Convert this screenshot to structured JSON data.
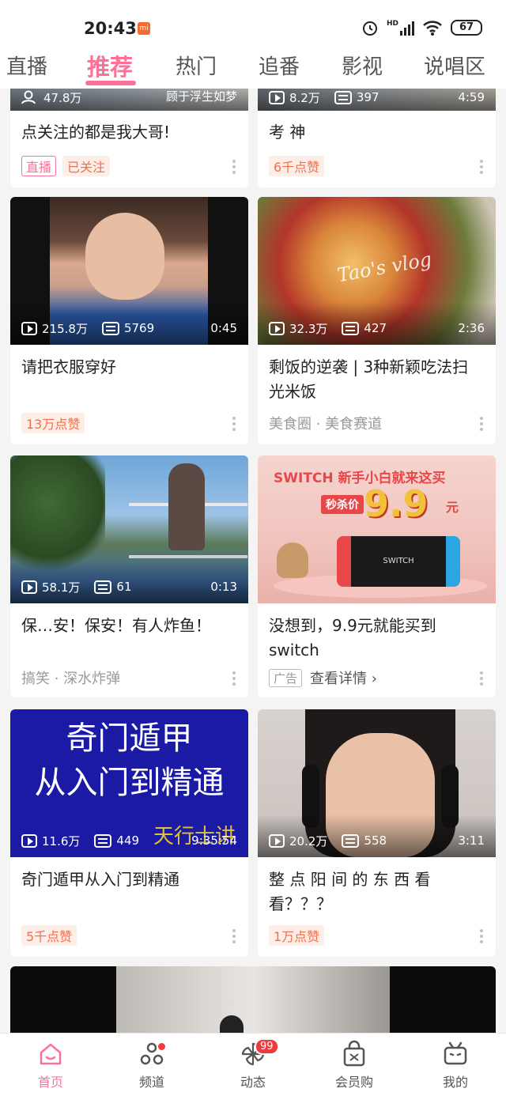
{
  "status_bar": {
    "time": "20:43",
    "signal": "HD",
    "battery": "67"
  },
  "tabs": [
    "直播",
    "推荐",
    "热门",
    "追番",
    "影视",
    "说唱区"
  ],
  "active_tab": "推荐",
  "cards": [
    {
      "plays": "47.8万",
      "uploader_overlay": "顾于浮生如梦",
      "title": "点关注的都是我大哥!",
      "live_badge": "直播",
      "followed_badge": "已关注"
    },
    {
      "plays": "8.2万",
      "danmaku": "397",
      "duration": "4:59",
      "title": "考  神",
      "likes": "6千点赞"
    },
    {
      "plays": "215.8万",
      "danmaku": "5769",
      "duration": "0:45",
      "title": "请把衣服穿好",
      "likes": "13万点赞"
    },
    {
      "plays": "32.3万",
      "danmaku": "427",
      "duration": "2:36",
      "title": "剩饭的逆袭 | 3种新颖吃法扫光米饭",
      "tags": "美食圈 · 美食赛道",
      "overlay_text": "Tao's vlog"
    },
    {
      "plays": "58.1万",
      "danmaku": "61",
      "duration": "0:13",
      "title": "保…安！保安！有人炸鱼！",
      "tags": "搞笑 · 深水炸弹"
    },
    {
      "title": "没想到，9.9元就能买到switch",
      "ad_badge": "广告",
      "ad_link": "查看详情 ›",
      "banner_title": "SWITCH 新手小白就来这买",
      "banner_price_label": "秒杀价",
      "banner_price": "9.9",
      "banner_unit": "元",
      "banner_device": "SWITCH"
    },
    {
      "plays": "11.6万",
      "danmaku": "449",
      "duration": "9:35:54",
      "title": "奇门遁甲从入门到精通",
      "likes": "5千点赞",
      "thumb_line1": "奇门遁甲",
      "thumb_line2": "从入门到精通",
      "thumb_signature": "天行士讲"
    },
    {
      "plays": "20.2万",
      "danmaku": "558",
      "duration": "3:11",
      "title": "整 点 阳 间 的 东 西 看 看？？？",
      "likes": "1万点赞"
    }
  ],
  "bottom_nav": [
    {
      "label": "首页",
      "icon": "home-icon"
    },
    {
      "label": "频道",
      "icon": "channel-icon"
    },
    {
      "label": "动态",
      "icon": "dynamic-icon",
      "badge": "99"
    },
    {
      "label": "会员购",
      "icon": "shopping-bag-icon"
    },
    {
      "label": "我的",
      "icon": "tv-icon"
    }
  ],
  "colors": {
    "accent": "#fb7299",
    "like": "#f26f4a"
  }
}
